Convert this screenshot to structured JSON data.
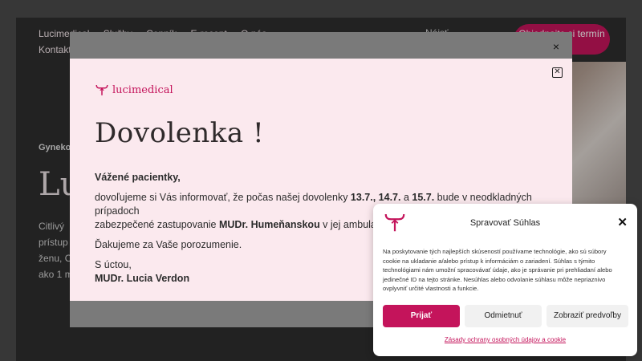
{
  "background_site": {
    "nav_items": [
      "Lucimedical",
      "Služby",
      "Cenník",
      "E-recept",
      "O nás"
    ],
    "nav_second_row": "Kontakt",
    "search_text": "Nájsť",
    "cta_label": "Objednajte si termín",
    "kicker": "Gynekológia",
    "hero_title": "Lu",
    "body_text": "Citlivý prístup pre ženu, O... ako 1 m..."
  },
  "modal": {
    "outer_close": "×",
    "inner_close": "✕",
    "brand_name": "lucimedical",
    "title": "Dovolenka !",
    "greeting": "Vážené pacientky,",
    "p1_a": "dovoľujeme si Vás informovať, že počas našej dovolenky ",
    "p1_dates1": "13.7., 14.7.",
    "p1_and": " a ",
    "p1_dates2": "15.7.",
    "p1_b": " bude v neodkladných prípadoch",
    "p1_c": "zabezpečené zastupovanie ",
    "p1_doctor": "MUDr. Humeňanskou",
    "p1_d": " v jej ambulancii v",
    "thanks": "Ďakujeme za Vaše porozumenie.",
    "closing": "S úctou,",
    "signature": "MUDr. Lucia Verdon"
  },
  "cookie": {
    "title": "Spravovať Súhlas",
    "close": "✕",
    "text": "Na poskytovanie tých najlepších skúseností používame technológie, ako sú súbory cookie na ukladanie a/alebo prístup k informáciám o zariadení. Súhlas s týmito technológiami nám umožní spracovávať údaje, ako je správanie pri prehliadaní alebo jedinečné ID na tejto stránke. Nesúhlas alebo odvolanie súhlasu môže nepriaznivo ovplyvniť určité vlastnosti a funkcie.",
    "accept": "Prijať",
    "deny": "Odmietnuť",
    "preferences": "Zobraziť predvoľby",
    "privacy_link": "Zásady ochrany osobných údajov a cookie"
  },
  "colors": {
    "brand": "#c4145b",
    "modal_bg": "#fbe9ee"
  }
}
